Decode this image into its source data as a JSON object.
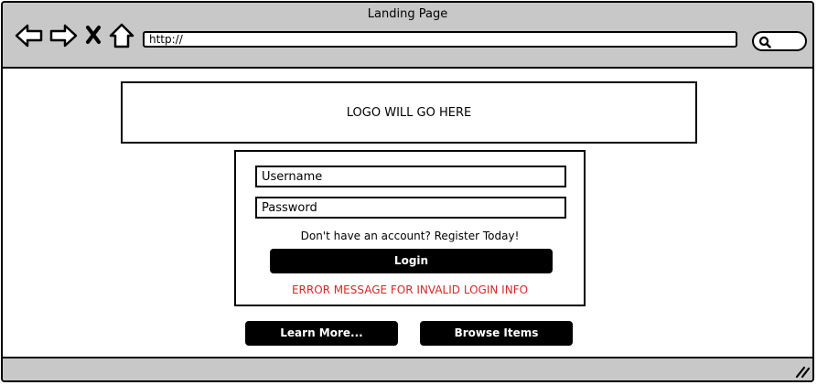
{
  "window": {
    "title": "Landing Page",
    "url": "http://"
  },
  "icons": {
    "back": "back-arrow-icon",
    "forward": "forward-arrow-icon",
    "close": "close-icon",
    "home": "home-icon",
    "search": "search-icon",
    "resize": "resize-grip-icon"
  },
  "logo": {
    "text": "LOGO WILL GO HERE"
  },
  "login": {
    "username_placeholder": "Username",
    "password_placeholder": "Password",
    "register_text": "Don't have an account? Register Today!",
    "login_label": "Login",
    "error_text": "ERROR MESSAGE FOR INVALID LOGIN INFO"
  },
  "actions": {
    "learn_more_label": "Learn More...",
    "browse_items_label": "Browse Items"
  },
  "colors": {
    "chrome": "#c8c8c8",
    "button": "#000000",
    "error": "#d62828"
  }
}
